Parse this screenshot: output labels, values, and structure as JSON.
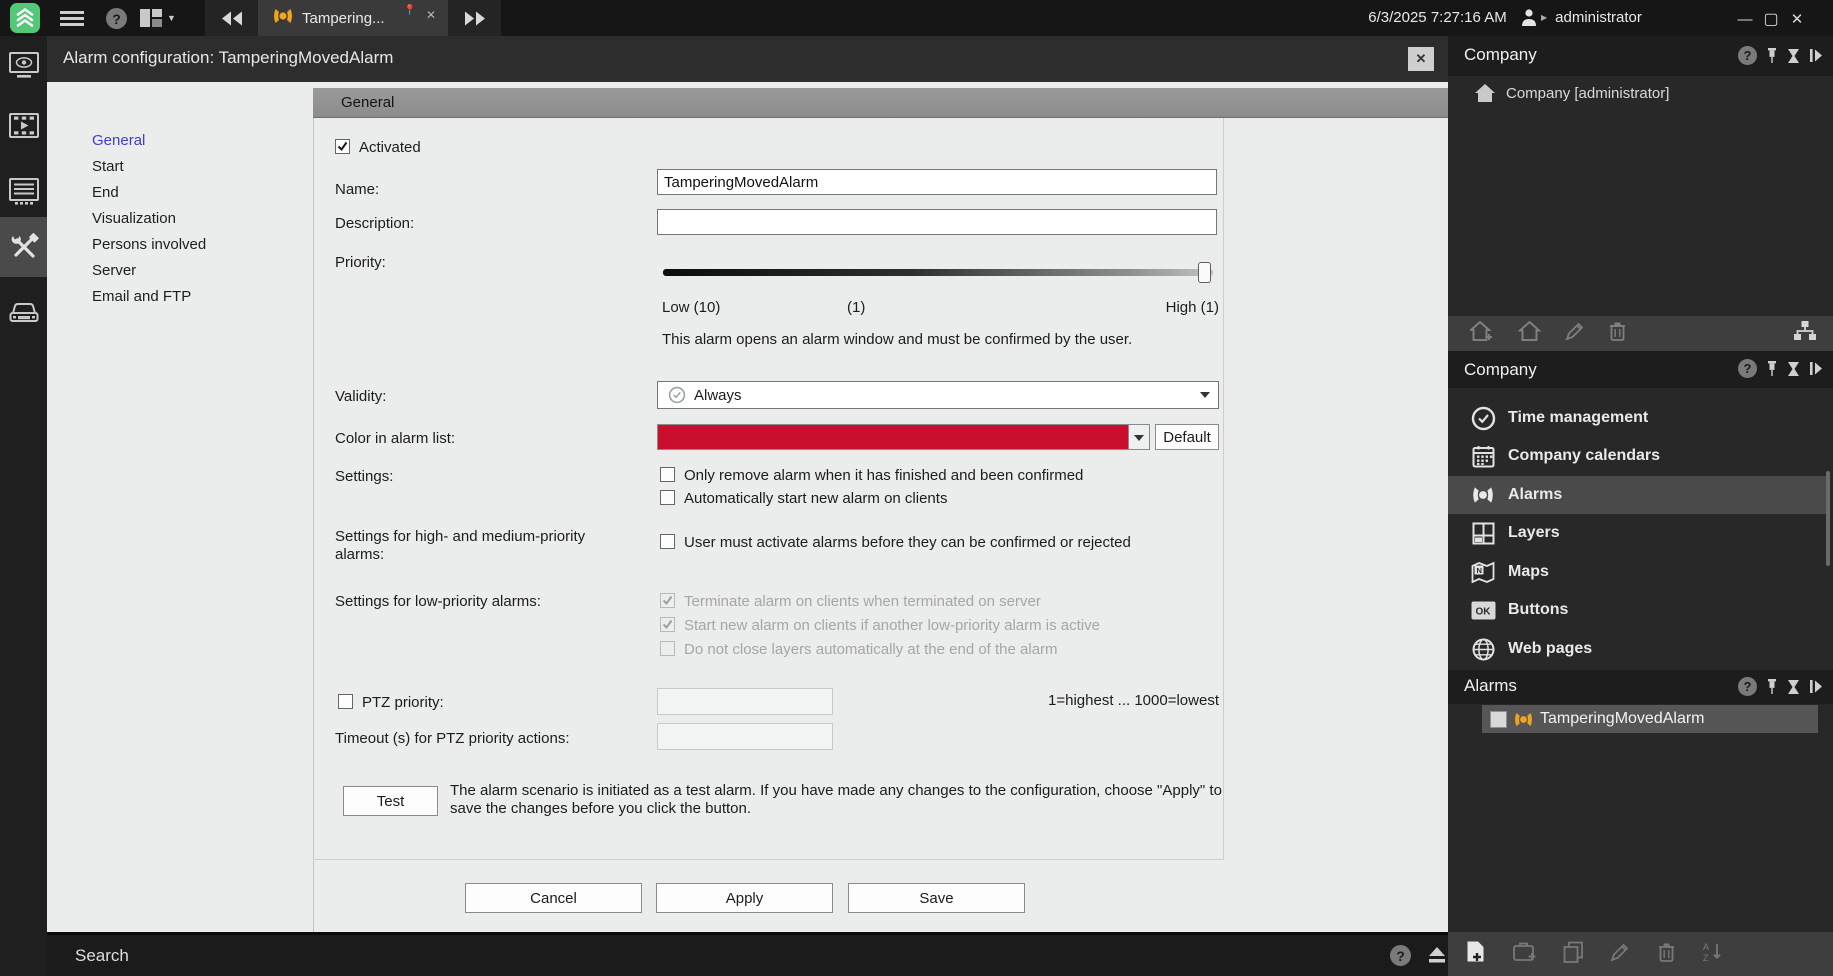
{
  "topbar": {
    "datetime": "6/3/2025 7:27:16 AM",
    "user": "administrator",
    "tab_label": "Tampering..."
  },
  "dialog": {
    "title": "Alarm configuration: TamperingMovedAlarm",
    "section_header": "General",
    "nav": [
      "General",
      "Start",
      "End",
      "Visualization",
      "Persons involved",
      "Server",
      "Email and FTP"
    ],
    "form": {
      "activated": {
        "label": "Activated",
        "checked": true
      },
      "name": {
        "label": "Name:",
        "value": "TamperingMovedAlarm"
      },
      "description": {
        "label": "Description:",
        "value": ""
      },
      "priority": {
        "label": "Priority:",
        "low": "Low (10)",
        "mid": "(1)",
        "high": "High (1)",
        "note": "This alarm opens an alarm window and must be confirmed by the user."
      },
      "validity": {
        "label": "Validity:",
        "value": "Always"
      },
      "color": {
        "label": "Color in alarm list:",
        "value": "#c90f2d",
        "default_button": "Default"
      },
      "settings": {
        "label": "Settings:",
        "options": [
          "Only remove alarm when it has finished and been confirmed",
          "Automatically start new alarm on clients"
        ]
      },
      "high_priority": {
        "label": "Settings for high- and medium-priority alarms:",
        "option": "User must activate alarms before they can be confirmed or rejected"
      },
      "low_priority": {
        "label": "Settings for low-priority alarms:",
        "options": [
          {
            "label": "Terminate alarm on clients when terminated on server",
            "checked": true
          },
          {
            "label": "Start new alarm on clients if another low-priority alarm is active",
            "checked": true
          },
          {
            "label": "Do not close layers automatically at the end of the alarm",
            "checked": false
          }
        ]
      },
      "ptz": {
        "label": "PTZ priority:",
        "range_note": "1=highest ... 1000=lowest"
      },
      "timeout": {
        "label": "Timeout (s) for PTZ priority actions:"
      },
      "test": {
        "button": "Test",
        "note": "The alarm scenario is initiated as a test alarm. If you have made any changes to the configuration, choose \"Apply\" to save the changes before you click the button."
      }
    },
    "footer": {
      "cancel": "Cancel",
      "apply": "Apply",
      "save": "Save"
    }
  },
  "search": {
    "label": "Search"
  },
  "right": {
    "company_tree": {
      "title": "Company",
      "root_label": "Company [administrator]"
    },
    "company_nav": {
      "title": "Company",
      "items": [
        "Time management",
        "Company calendars",
        "Alarms",
        "Layers",
        "Maps",
        "Buttons",
        "Web pages"
      ],
      "selected": "Alarms"
    },
    "alarms": {
      "title": "Alarms",
      "items": [
        "TamperingMovedAlarm"
      ]
    }
  },
  "colors": {
    "accent_red": "#c90f2d",
    "alarm_orange": "#f0a41e",
    "logo_green": "#53c877"
  },
  "icons": [
    "logo",
    "menu",
    "help",
    "layout",
    "rewind",
    "alarm",
    "forward",
    "user",
    "surveillance",
    "archive",
    "report",
    "configuration",
    "lpr",
    "home",
    "clock",
    "calendar",
    "layers",
    "map",
    "ok-button",
    "globe",
    "pin",
    "hourglass",
    "collapse",
    "edit",
    "delete",
    "hierarchy",
    "new-document",
    "add-case",
    "copy",
    "sort",
    "eject"
  ]
}
